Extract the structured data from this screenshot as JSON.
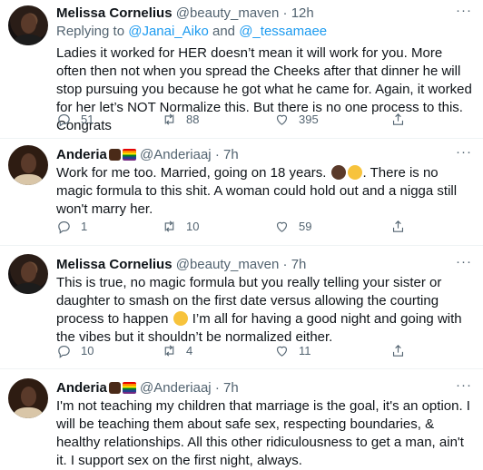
{
  "tweets": [
    {
      "name": "Melissa Cornelius",
      "handle": "@beauty_maven",
      "time": "12h",
      "replying_prefix": "Replying to",
      "replying_to_1": "@Janai_Aiko",
      "replying_and": "and",
      "replying_to_2": "@_tessamaee",
      "text": "Ladies it worked for HER doesn’t mean it will work for you. More often then not when you spread the Cheeks after that dinner he will stop pursuing you because he got what he came for. Again, it worked for her let’s NOT Normalize this. But there is no one process to this. Congrats",
      "replies": "51",
      "retweets": "88",
      "likes": "395"
    },
    {
      "name": "Anderia",
      "handle": "@Anderiaaj",
      "time": "7h",
      "text_a": "Work for me too. Married, going on 18 years.",
      "text_b": ". There is no magic formula to this shit. A woman could hold out and a nigga still won't marry her.",
      "replies": "1",
      "retweets": "10",
      "likes": "59"
    },
    {
      "name": "Melissa Cornelius",
      "handle": "@beauty_maven",
      "time": "7h",
      "text_a": "This is true, no magic formula but you really telling your sister or daughter to smash on the first date versus allowing the courting process to happen",
      "text_b": " I’m all for having a good night and going with the vibes but it shouldn’t be normalized either.",
      "replies": "10",
      "retweets": "4",
      "likes": "11"
    },
    {
      "name": "Anderia",
      "handle": "@Anderiaaj",
      "time": "7h",
      "text": "I'm not teaching my children that marriage is the goal, it's an option. I will be teaching them about safe sex, respecting boundaries, & healthy relationships. All this other ridiculousness to get a man, ain't it. I support sex on the first night, always."
    }
  ],
  "ui": {
    "separator": "·",
    "more": "···"
  },
  "colors": {
    "link": "#1d9bf0",
    "muted": "#536471",
    "text": "#0f1419"
  },
  "icons": [
    "reply-icon",
    "retweet-icon",
    "like-icon",
    "share-icon",
    "more-icon"
  ]
}
